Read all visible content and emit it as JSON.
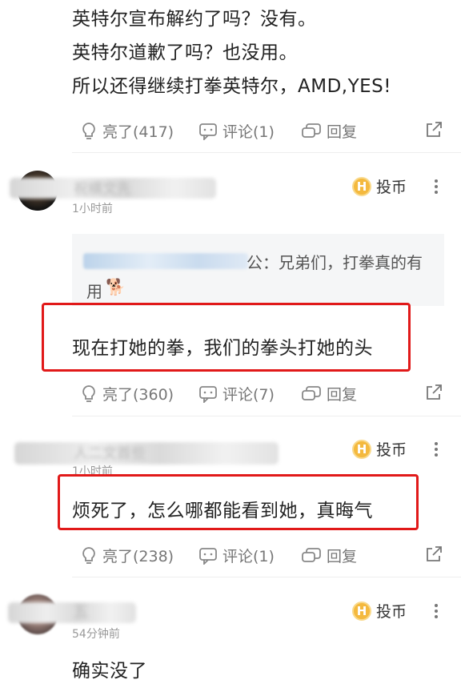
{
  "post": {
    "lines": [
      "英特尔宣布解约了吗？没有。",
      "英特尔道歉了吗？也没用。",
      "所以还得继续打拳英特尔，AMD,YES!"
    ],
    "likes": "亮了(417)",
    "comments": "评论(1)",
    "reply": "回复"
  },
  "comments": [
    {
      "name": "祝横文先",
      "time": "1小时前",
      "coin": "投币",
      "quote_text": "公：兄弟们，打拳真的有",
      "quote_text2": "用",
      "emoji": "🐕",
      "text": "现在打她的拳，我们的拳头打她的头",
      "likes": "亮了(360)",
      "comments": "评论(7)",
      "reply": "回复"
    },
    {
      "name": "人二文首些",
      "time": "1小时前",
      "coin": "投币",
      "text": "烦死了，怎么哪都能看到她，真晦气",
      "likes": "亮了(238)",
      "comments": "评论(1)",
      "reply": "回复"
    },
    {
      "name": "五",
      "time": "54分钟前",
      "coin": "投币",
      "text": "确实没了"
    }
  ],
  "colors": {
    "highlight": "#e11919",
    "coin": "#f4b93e",
    "meta": "#777777"
  }
}
